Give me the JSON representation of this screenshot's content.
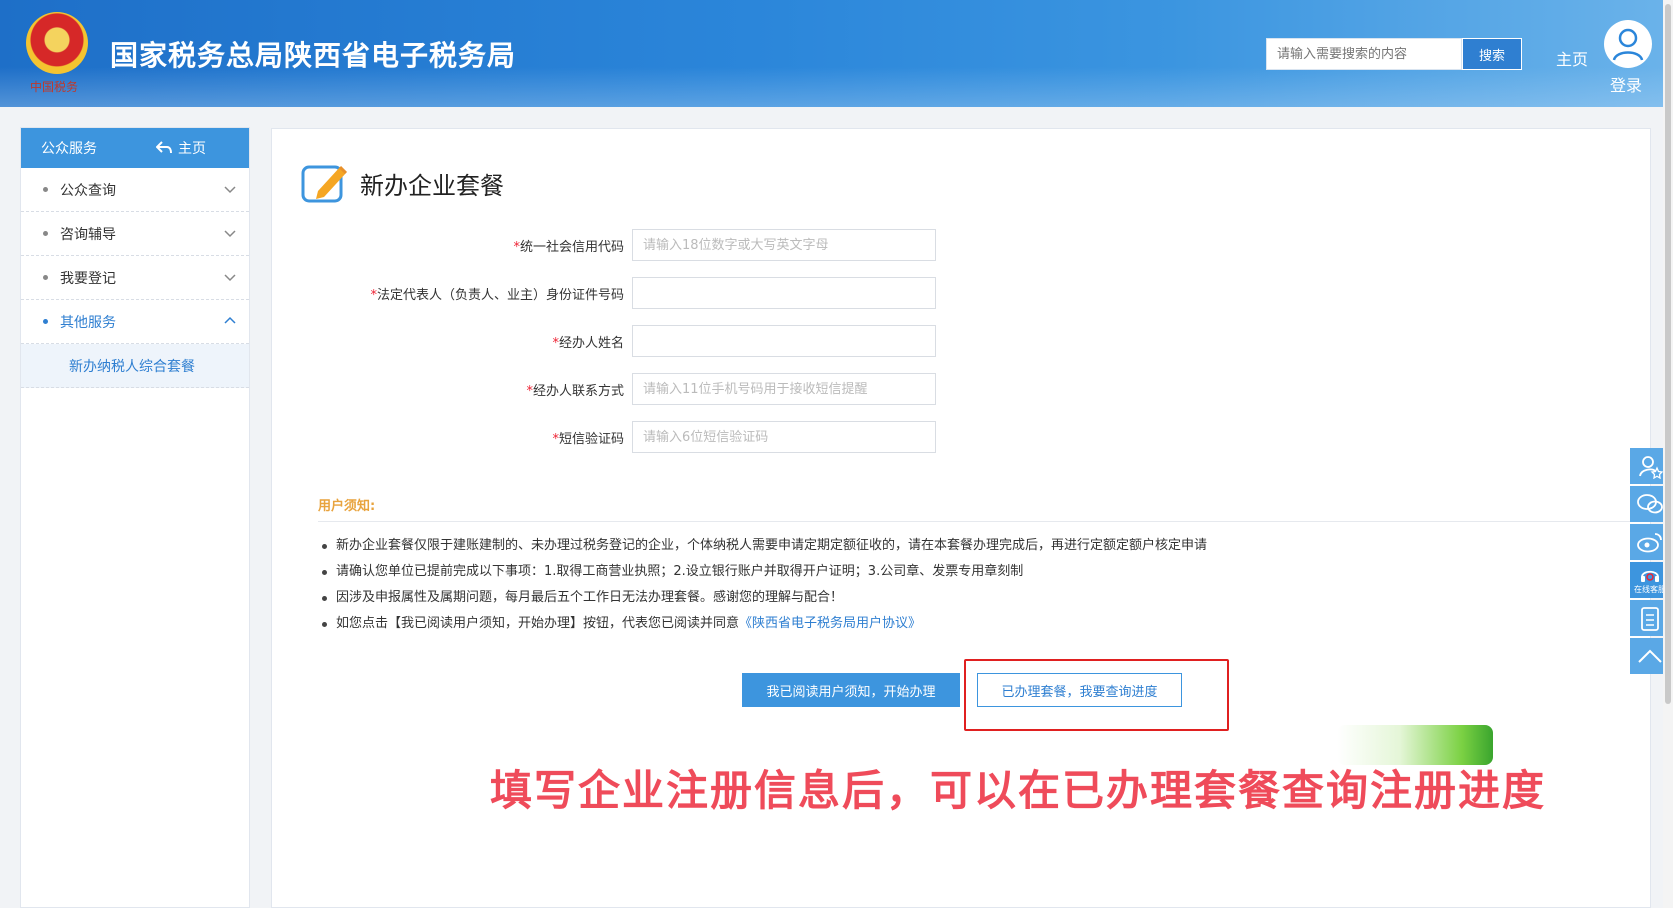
{
  "header": {
    "site_title": "国家税务总局陕西省电子税务局",
    "emblem_text": "中国税务",
    "search_placeholder": "请输入需要搜索的内容",
    "search_button": "搜索",
    "home_link": "主页",
    "login_link": "登录"
  },
  "sidebar": {
    "section_title": "公众服务",
    "home_label": "主页",
    "items": [
      {
        "label": "公众查询",
        "expanded": false
      },
      {
        "label": "咨询辅导",
        "expanded": false
      },
      {
        "label": "我要登记",
        "expanded": false
      },
      {
        "label": "其他服务",
        "expanded": true
      }
    ],
    "sub_items": [
      {
        "label": "新办纳税人综合套餐"
      }
    ]
  },
  "main": {
    "page_title": "新办企业套餐",
    "form": {
      "fields": [
        {
          "label": "统一社会信用代码",
          "required": "*",
          "placeholder": "请输入18位数字或大写英文字母",
          "value": ""
        },
        {
          "label": "法定代表人（负责人、业主）身份证件号码",
          "required": "*",
          "placeholder": "",
          "value": ""
        },
        {
          "label": "经办人姓名",
          "required": "*",
          "placeholder": "",
          "value": ""
        },
        {
          "label": "经办人联系方式",
          "required": "*",
          "placeholder": "请输入11位手机号码用于接收短信提醒",
          "value": ""
        },
        {
          "label": "短信验证码",
          "required": "*",
          "placeholder": "请输入6位短信验证码",
          "value": ""
        }
      ]
    },
    "notice": {
      "title": "用户须知:",
      "items": [
        "新办企业套餐仅限于建账建制的、未办理过税务登记的企业，个体纳税人需要申请定期定额征收的，请在本套餐办理完成后，再进行定额定额户核定申请",
        "请确认您单位已提前完成以下事项：1.取得工商营业执照；2.设立银行账户并取得开户证明；3.公司章、发票专用章刻制",
        "因涉及申报属性及属期问题，每月最后五个工作日无法办理套餐。感谢您的理解与配合！"
      ],
      "last_item_prefix": "如您点击【我已阅读用户须知，开始办理】按钮，代表您已阅读并同意",
      "agreement_link": "《陕西省电子税务局用户协议》"
    },
    "buttons": {
      "start": "我已阅读用户须知，开始办理",
      "query_progress": "已办理套餐，我要查询进度"
    },
    "annotation": "填写企业注册信息后，可以在已办理套餐查询注册进度"
  },
  "side_tools": [
    {
      "icon": "user-star-icon",
      "label": ""
    },
    {
      "icon": "wechat-icon",
      "label": ""
    },
    {
      "icon": "weibo-icon",
      "label": ""
    },
    {
      "icon": "online-service-icon",
      "label": "在线客服"
    },
    {
      "icon": "clipboard-icon",
      "label": ""
    },
    {
      "icon": "back-to-top-icon",
      "label": ""
    }
  ],
  "colors": {
    "header_blue": "#2b86da",
    "accent_blue": "#3d95de",
    "link_blue": "#2f7fd1",
    "notice_orange": "#e8a33d",
    "highlight_red": "#e02020",
    "annotation_pink": "#ef4b5a"
  }
}
